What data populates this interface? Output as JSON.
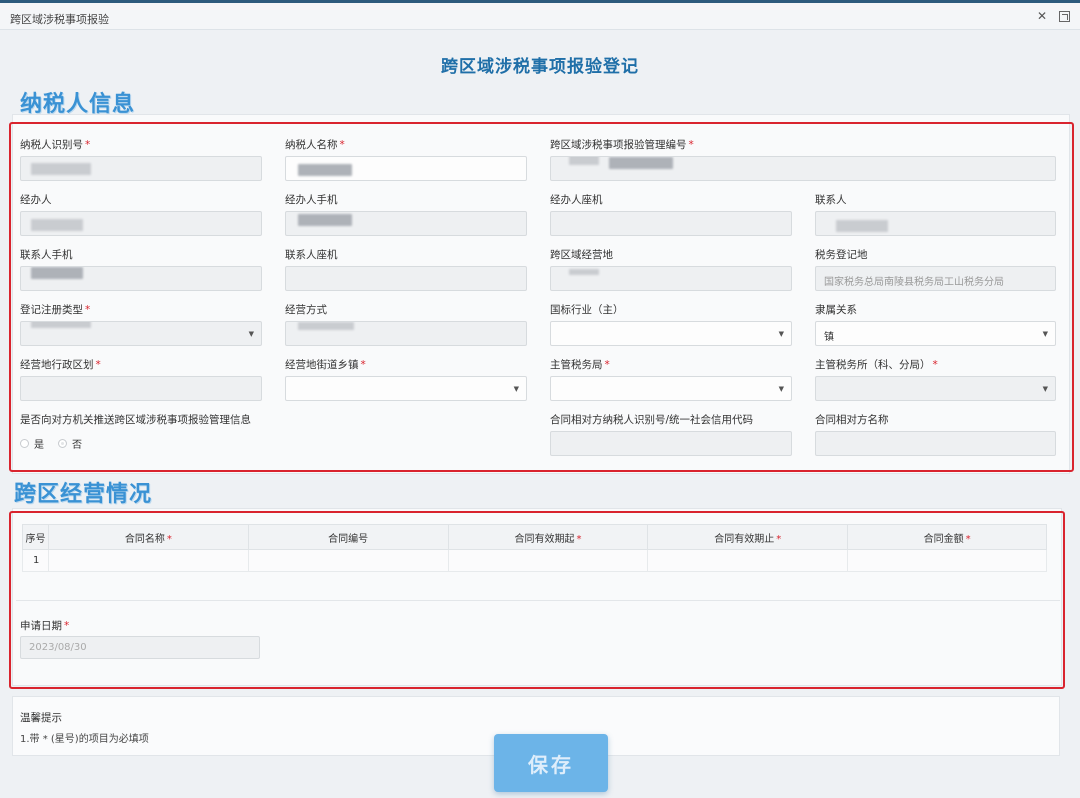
{
  "window": {
    "title": "跨区域涉税事项报验",
    "controls": [
      "close-icon",
      "maximize-icon"
    ]
  },
  "page_title": "跨区域涉税事项报验登记",
  "taxpayer_section": {
    "banner": "纳税人信息",
    "fields": {
      "taxpayer_id": {
        "label": "纳税人识别号",
        "required": true,
        "value": ""
      },
      "taxpayer_name": {
        "label": "纳税人名称",
        "required": true,
        "value": ""
      },
      "mgmt_no": {
        "label": "跨区域涉税事项报验管理编号",
        "required": true,
        "value": ""
      },
      "handler": {
        "label": "经办人",
        "required": false,
        "value": ""
      },
      "handler_mobile": {
        "label": "经办人手机",
        "required": false,
        "value": ""
      },
      "handler_landline": {
        "label": "经办人座机",
        "required": false,
        "value": ""
      },
      "contact": {
        "label": "联系人",
        "required": false,
        "value": ""
      },
      "contact_mobile": {
        "label": "联系人手机",
        "required": false,
        "value": ""
      },
      "contact_landline": {
        "label": "联系人座机",
        "required": false,
        "value": ""
      },
      "cross_region_place": {
        "label": "跨区域经营地",
        "required": false,
        "value": ""
      },
      "tax_reg_place": {
        "label": "税务登记地",
        "required": false,
        "value": "国家税务总局南陵县税务局工山税务分局"
      },
      "reg_type": {
        "label": "登记注册类型",
        "required": true,
        "value": ""
      },
      "biz_mode": {
        "label": "经营方式",
        "required": false,
        "value": ""
      },
      "industry": {
        "label": "国标行业（主）",
        "required": false,
        "value": ""
      },
      "affiliation": {
        "label": "隶属关系",
        "required": false,
        "value": "镇"
      },
      "admin_division": {
        "label": "经营地行政区划",
        "required": true,
        "value": ""
      },
      "street_town": {
        "label": "经营地街道乡镇",
        "required": true,
        "value": ""
      },
      "tax_bureau": {
        "label": "主管税务局",
        "required": true,
        "value": ""
      },
      "tax_office": {
        "label": "主管税务所（科、分局）",
        "required": true,
        "value": ""
      },
      "push_info": {
        "label": "是否向对方机关推送跨区域涉税事项报验管理信息",
        "required": false,
        "options": [
          "是",
          "否"
        ],
        "selected": "否"
      },
      "counterparty_id": {
        "label": "合同相对方纳税人识别号/统一社会信用代码",
        "required": false,
        "value": ""
      },
      "counterparty_name": {
        "label": "合同相对方名称",
        "required": false,
        "value": ""
      }
    }
  },
  "business_section": {
    "banner": "跨区经营情况",
    "table": {
      "columns": [
        {
          "label": "序号",
          "required": false
        },
        {
          "label": "合同名称",
          "required": true
        },
        {
          "label": "合同编号",
          "required": false
        },
        {
          "label": "合同有效期起",
          "required": true
        },
        {
          "label": "合同有效期止",
          "required": true
        },
        {
          "label": "合同金额",
          "required": true
        }
      ],
      "rows": [
        {
          "no": "1",
          "name": "",
          "code": "",
          "start": "",
          "end": "",
          "amount": ""
        }
      ]
    },
    "apply_date": {
      "label": "申请日期",
      "required": true,
      "value": "2023/08/30"
    }
  },
  "tips": {
    "title": "温馨提示",
    "text": "1.带 * (星号)的项目为必填项"
  },
  "save_label": "保存",
  "colors": {
    "accent": "#1f6fa8",
    "banner": "#3a92d4",
    "highlight_box": "#d9242e",
    "required_star": "#d9242e",
    "save_button": "#6cb4e8"
  }
}
